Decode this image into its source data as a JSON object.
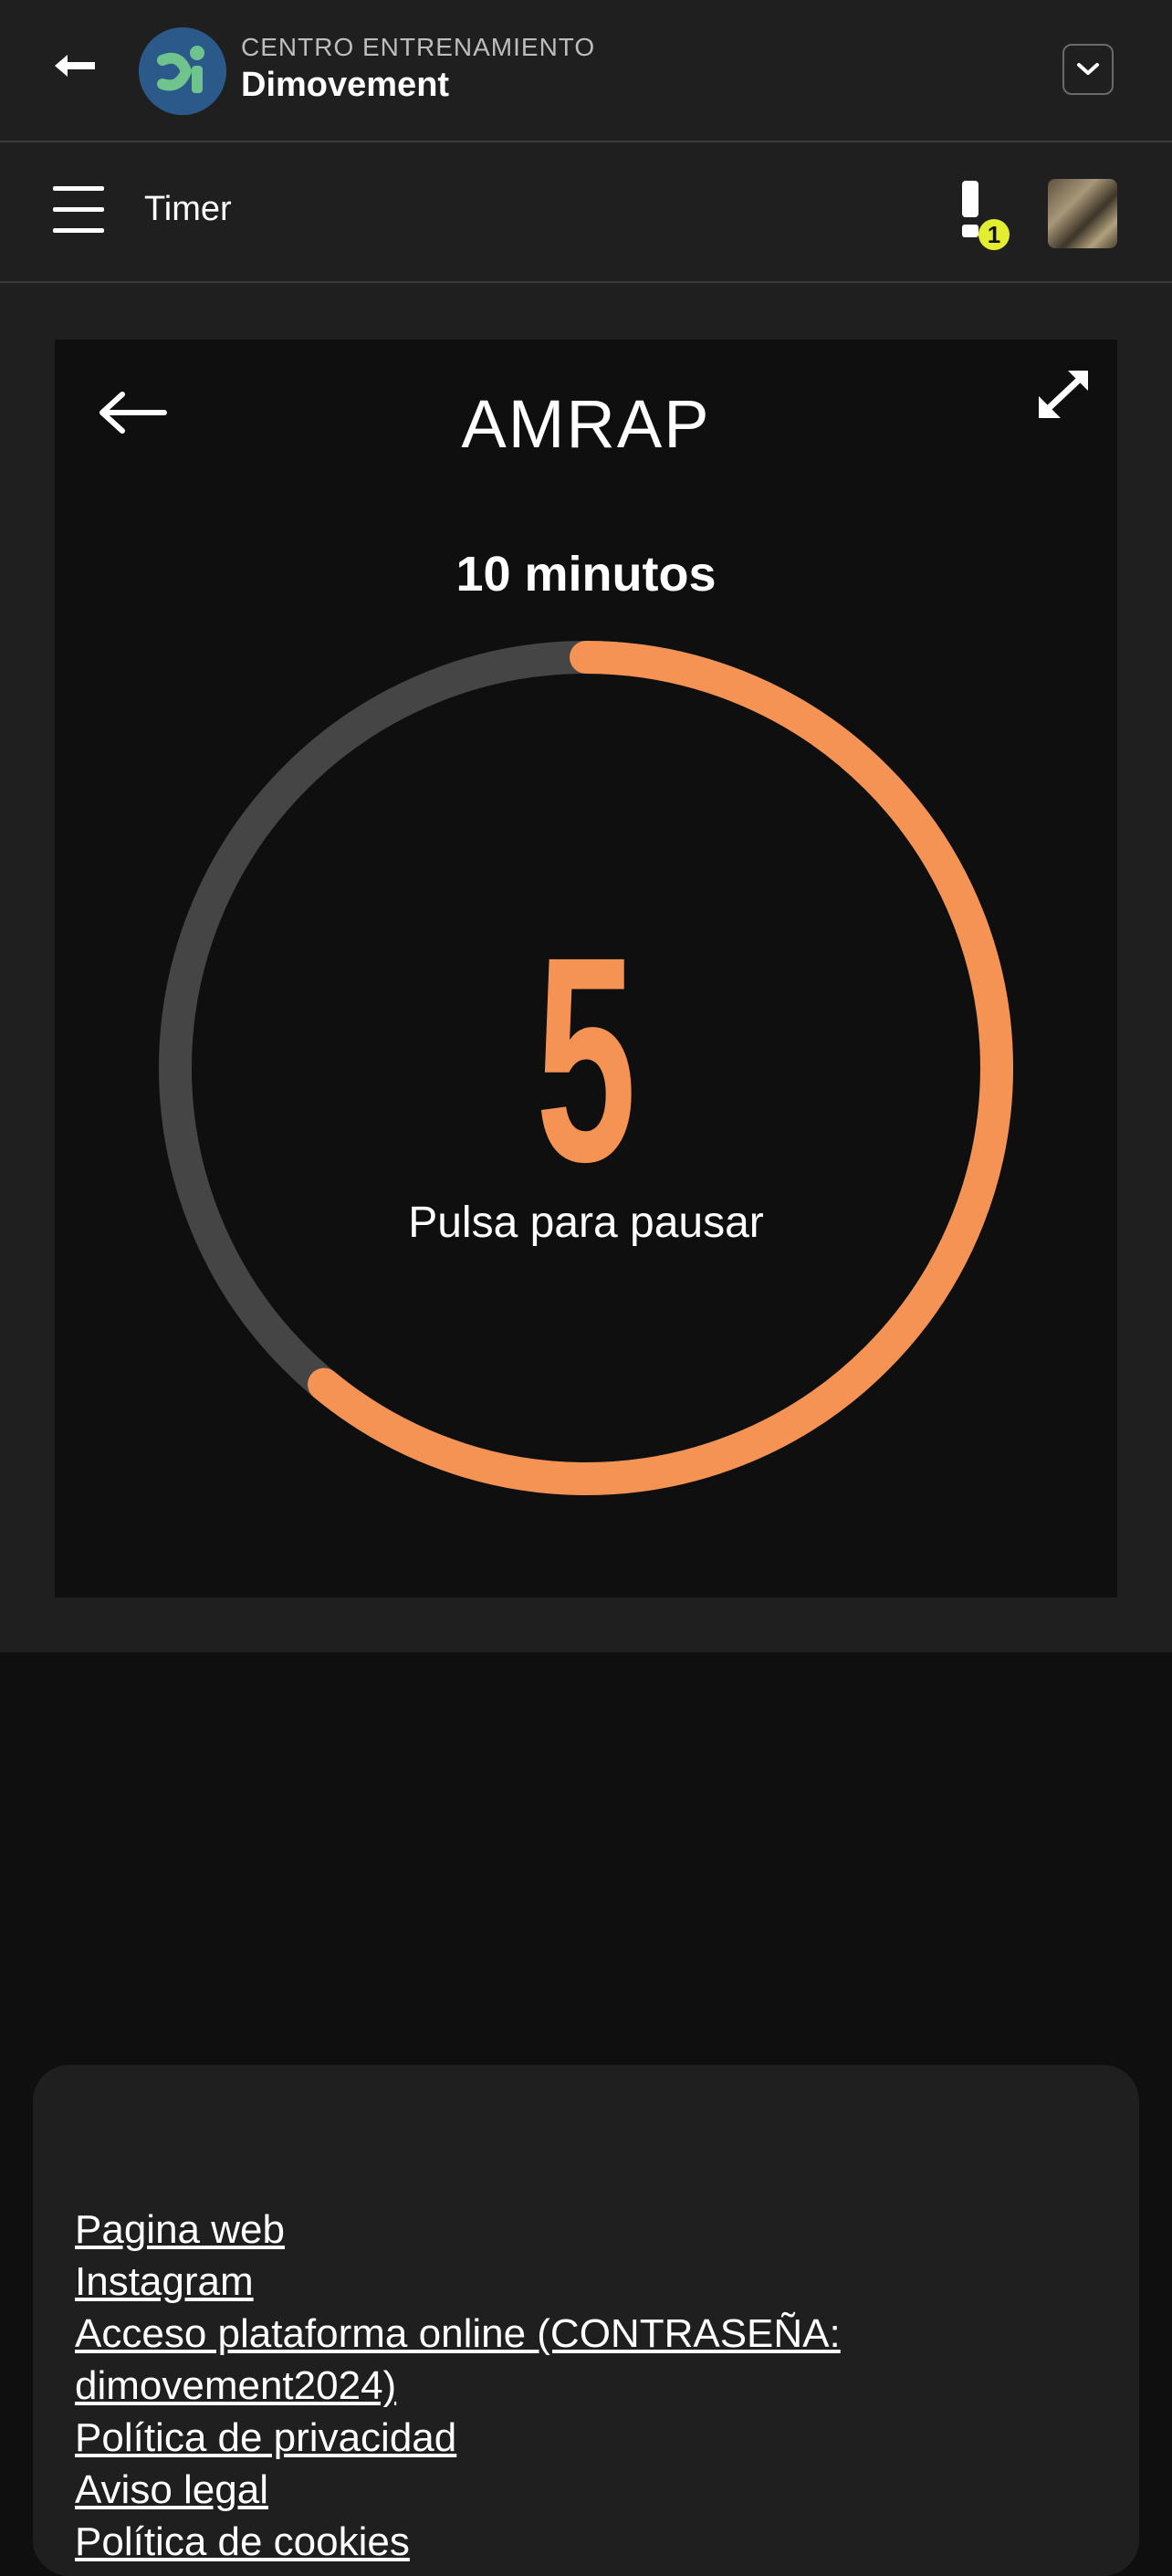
{
  "header": {
    "subtitle": "CENTRO ENTRENAMIENTO",
    "title": "Dimovement"
  },
  "nav": {
    "title": "Timer",
    "alert_count": "1"
  },
  "timer": {
    "mode": "AMRAP",
    "duration": "10 minutos",
    "count": "5",
    "hint": "Pulsa para pausar",
    "progress": 0.61,
    "colors": {
      "accent": "#f59355",
      "track": "#454545"
    }
  },
  "footer": {
    "links": [
      "Pagina web",
      "Instagram",
      "Acceso plataforma online (CONTRASEÑA: dimovement2024)",
      "Política de privacidad",
      "Aviso legal",
      "Política de cookies"
    ]
  }
}
